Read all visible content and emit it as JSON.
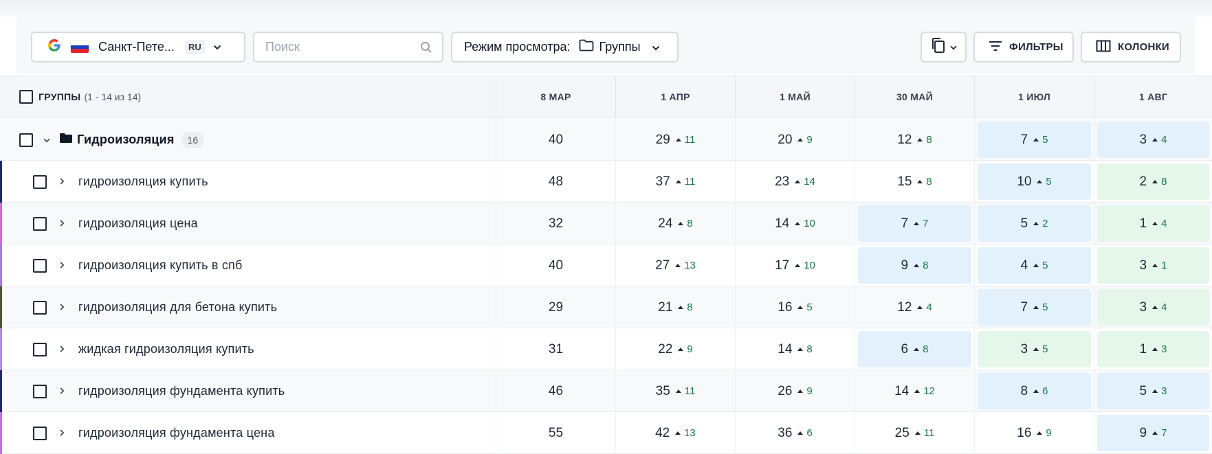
{
  "toolbar": {
    "engine_icon": "google-icon",
    "country_flag": "russia-flag",
    "location": "Санкт-Пете...",
    "language": "RU",
    "search_placeholder": "Поиск",
    "view_mode_label": "Режим просмотра:",
    "view_mode_value": "Группы",
    "filters_label": "ФИЛЬТРЫ",
    "columns_label": "КОЛОНКИ"
  },
  "table": {
    "header_title": "ГРУППЫ",
    "header_count": "(1 - 14 из 14)",
    "columns": [
      "8 МАР",
      "1 АПР",
      "1 МАЙ",
      "30 МАЙ",
      "1 ИЮЛ",
      "1 АВГ"
    ],
    "highlight_colors": {
      "blue": "#e2f1fc",
      "green": "#e5f6ea"
    },
    "change_color": "#16794a",
    "rows": [
      {
        "type": "group",
        "name": "Гидроизоляция",
        "count": "16",
        "accent": "",
        "cells": [
          {
            "pos": "40",
            "delta": "",
            "hl": ""
          },
          {
            "pos": "29",
            "delta": "11",
            "hl": ""
          },
          {
            "pos": "20",
            "delta": "9",
            "hl": ""
          },
          {
            "pos": "12",
            "delta": "8",
            "hl": ""
          },
          {
            "pos": "7",
            "delta": "5",
            "hl": "blue"
          },
          {
            "pos": "3",
            "delta": "4",
            "hl": "blue"
          }
        ]
      },
      {
        "type": "keyword",
        "name": "гидроизоляция купить",
        "accent": "#1e2a6e",
        "cells": [
          {
            "pos": "48",
            "delta": "",
            "hl": ""
          },
          {
            "pos": "37",
            "delta": "11",
            "hl": ""
          },
          {
            "pos": "23",
            "delta": "14",
            "hl": ""
          },
          {
            "pos": "15",
            "delta": "8",
            "hl": ""
          },
          {
            "pos": "10",
            "delta": "5",
            "hl": "blue"
          },
          {
            "pos": "2",
            "delta": "8",
            "hl": "green"
          }
        ]
      },
      {
        "type": "keyword",
        "name": "гидроизоляция цена",
        "accent": "#d46ad8",
        "cells": [
          {
            "pos": "32",
            "delta": "",
            "hl": ""
          },
          {
            "pos": "24",
            "delta": "8",
            "hl": ""
          },
          {
            "pos": "14",
            "delta": "10",
            "hl": ""
          },
          {
            "pos": "7",
            "delta": "7",
            "hl": "blue"
          },
          {
            "pos": "5",
            "delta": "2",
            "hl": "blue"
          },
          {
            "pos": "1",
            "delta": "4",
            "hl": "green"
          }
        ]
      },
      {
        "type": "keyword",
        "name": "гидроизоляция купить в спб",
        "accent": "#a879e0",
        "cells": [
          {
            "pos": "40",
            "delta": "",
            "hl": ""
          },
          {
            "pos": "27",
            "delta": "13",
            "hl": ""
          },
          {
            "pos": "17",
            "delta": "10",
            "hl": ""
          },
          {
            "pos": "9",
            "delta": "8",
            "hl": "blue"
          },
          {
            "pos": "4",
            "delta": "5",
            "hl": "blue"
          },
          {
            "pos": "3",
            "delta": "1",
            "hl": "green"
          }
        ]
      },
      {
        "type": "keyword",
        "name": "гидроизоляция для бетона купить",
        "accent": "#4b5a2a",
        "cells": [
          {
            "pos": "29",
            "delta": "",
            "hl": ""
          },
          {
            "pos": "21",
            "delta": "8",
            "hl": ""
          },
          {
            "pos": "16",
            "delta": "5",
            "hl": ""
          },
          {
            "pos": "12",
            "delta": "4",
            "hl": ""
          },
          {
            "pos": "7",
            "delta": "5",
            "hl": "blue"
          },
          {
            "pos": "3",
            "delta": "4",
            "hl": "green"
          }
        ]
      },
      {
        "type": "keyword",
        "name": "жидкая гидроизоляция купить",
        "accent": "#b98ae8",
        "cells": [
          {
            "pos": "31",
            "delta": "",
            "hl": ""
          },
          {
            "pos": "22",
            "delta": "9",
            "hl": ""
          },
          {
            "pos": "14",
            "delta": "8",
            "hl": ""
          },
          {
            "pos": "6",
            "delta": "8",
            "hl": "blue"
          },
          {
            "pos": "3",
            "delta": "5",
            "hl": "green"
          },
          {
            "pos": "1",
            "delta": "3",
            "hl": "green"
          }
        ]
      },
      {
        "type": "keyword",
        "name": "гидроизоляция фундамента купить",
        "accent": "#1e2a6e",
        "cells": [
          {
            "pos": "46",
            "delta": "",
            "hl": ""
          },
          {
            "pos": "35",
            "delta": "11",
            "hl": ""
          },
          {
            "pos": "26",
            "delta": "9",
            "hl": ""
          },
          {
            "pos": "14",
            "delta": "12",
            "hl": ""
          },
          {
            "pos": "8",
            "delta": "6",
            "hl": "blue"
          },
          {
            "pos": "5",
            "delta": "3",
            "hl": "blue"
          }
        ]
      },
      {
        "type": "keyword",
        "name": "гидроизоляция фундамента цена",
        "accent": "#c46fe0",
        "cells": [
          {
            "pos": "55",
            "delta": "",
            "hl": ""
          },
          {
            "pos": "42",
            "delta": "13",
            "hl": ""
          },
          {
            "pos": "36",
            "delta": "6",
            "hl": ""
          },
          {
            "pos": "25",
            "delta": "11",
            "hl": ""
          },
          {
            "pos": "16",
            "delta": "9",
            "hl": ""
          },
          {
            "pos": "9",
            "delta": "7",
            "hl": "blue"
          }
        ]
      }
    ]
  }
}
